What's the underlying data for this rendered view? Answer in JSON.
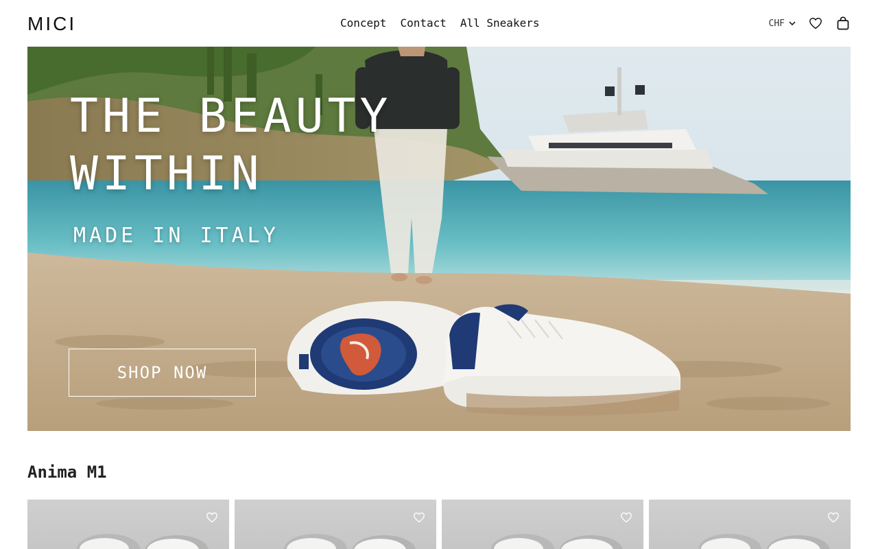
{
  "header": {
    "logo": "MICI",
    "nav": [
      "Concept",
      "Contact",
      "All Sneakers"
    ],
    "currency": "CHF",
    "icons": {
      "currency_dropdown": "chevron-down-icon",
      "wishlist": "heart-icon",
      "cart": "shopping-bag-icon"
    }
  },
  "hero": {
    "title_line1": "THE BEAUTY",
    "title_line2": "WITHIN",
    "subtitle": "MADE IN ITALY",
    "cta": "SHOP NOW"
  },
  "section": {
    "title": "Anima M1",
    "products": [
      {
        "wishlist_icon": "heart-icon"
      },
      {
        "wishlist_icon": "heart-icon"
      },
      {
        "wishlist_icon": "heart-icon"
      },
      {
        "wishlist_icon": "heart-icon"
      }
    ]
  },
  "colors": {
    "text": "#111111",
    "sky": "#cfe3ee",
    "sea": "#3fa9b5",
    "sand": "#c9b08c",
    "card_bg": "#cbcbcb"
  }
}
